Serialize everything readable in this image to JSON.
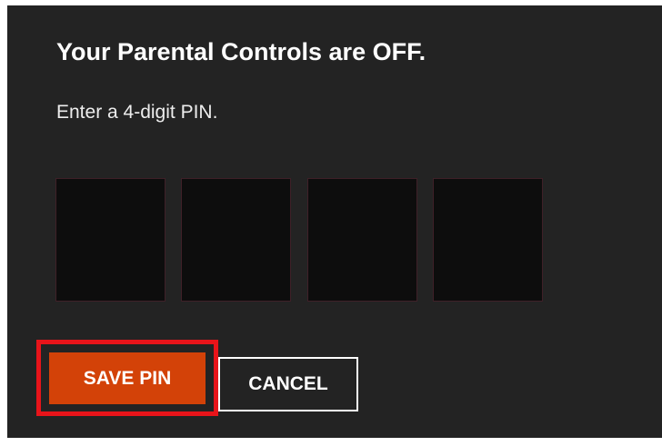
{
  "dialog": {
    "title": "Your Parental Controls are OFF.",
    "instruction": "Enter a 4-digit PIN.",
    "pin_digits": [
      "",
      "",
      "",
      ""
    ]
  },
  "actions": {
    "save_label": "SAVE PIN",
    "cancel_label": "CANCEL"
  },
  "colors": {
    "panel_background": "#232323",
    "pin_box_background": "#0d0d0d",
    "save_button": "#d34208",
    "highlight_outline": "#e8141a"
  }
}
